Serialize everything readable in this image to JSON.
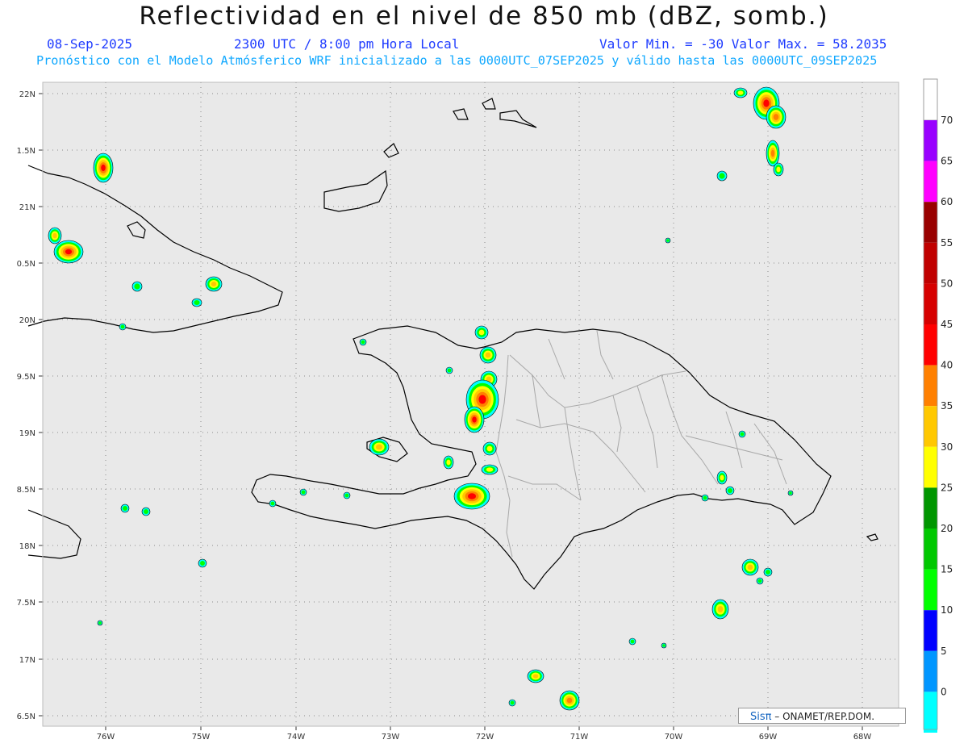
{
  "header": {
    "title": "Reflectividad en el nivel de 850 mb (dBZ, somb.)",
    "date": "08-Sep-2025",
    "time": "2300 UTC / 8:00 pm Hora Local",
    "minmax": "Valor Min. = -30  Valor Max. = 58.2035",
    "forecast": "Pronóstico con el Modelo Atmósferico WRF inicializado a las 0000UTC_07SEP2025 y válido hasta las  0000UTC_09SEP2025"
  },
  "map": {
    "lon_range": [
      -76.75,
      -67.75
    ],
    "lat_range": [
      16.4,
      22.1
    ],
    "lat_labels": [
      "22N",
      "1.5N",
      "21N",
      "0.5N",
      "20N",
      "9.5N",
      "19N",
      "8.5N",
      "18N",
      "7.5N",
      "17N",
      "6.5N"
    ],
    "lon_labels": [
      "76W",
      "75W",
      "74W",
      "73W",
      "72W",
      "71W",
      "70W",
      "69W",
      "68W"
    ],
    "background_color": "#e9e9e9",
    "coast_color": "#000000",
    "border_color": "#a8a8a8"
  },
  "colorbar": {
    "labels": [
      "0",
      "5",
      "10",
      "15",
      "20",
      "25",
      "30",
      "35",
      "40",
      "45",
      "50",
      "55",
      "60",
      "65",
      "70"
    ],
    "colors": [
      "#00ffff",
      "#0096ff",
      "#0000ff",
      "#00ff00",
      "#00c800",
      "#009600",
      "#ffff00",
      "#ffc800",
      "#ff8000",
      "#ff0000",
      "#d60000",
      "#c00000",
      "#990000",
      "#ff00ff",
      "#9900ff"
    ]
  },
  "credit": {
    "brand": "Sisπ",
    "text": "– ONAMET/REP.DOM."
  }
}
